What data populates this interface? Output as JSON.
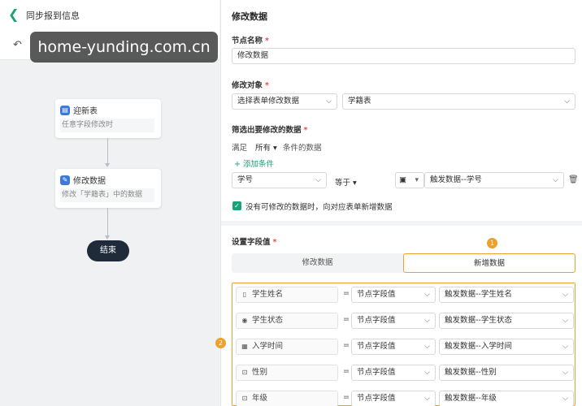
{
  "header": {
    "title": "同步报到信息"
  },
  "watermark": "home-yunding.com.cn",
  "flow": {
    "node1": {
      "title": "迎新表",
      "subtitle": "任意字段修改时"
    },
    "node2": {
      "title": "修改数据",
      "subtitle": "修改「学籍表」中的数据"
    },
    "end_label": "结束"
  },
  "panel": {
    "title": "修改数据",
    "node_name_label": "节点名称",
    "node_name_value": "修改数据",
    "target_label": "修改对象",
    "target_mode": "选择表单修改数据",
    "target_table": "学籍表",
    "filter_label": "筛选出要修改的数据",
    "filter_prefix": "满足",
    "filter_scope": "所有",
    "filter_suffix": "条件的数据",
    "add_condition": "添加条件",
    "condition": {
      "field": "学号",
      "operator": "等于",
      "value": "触发数据--学号"
    },
    "insert_if_none": "没有可修改的数据时，向对应表单新增数据",
    "set_fields_label": "设置字段值",
    "tabs": [
      "修改数据",
      "新增数据"
    ],
    "active_tab": 1,
    "badges": [
      "1",
      "2"
    ],
    "field_rows": [
      {
        "name": "学生姓名",
        "icon": "text-field-icon",
        "glyph": "▯",
        "eq": "=",
        "mode": "节点字段值",
        "value": "触发数据--学生姓名"
      },
      {
        "name": "学生状态",
        "icon": "radio-field-icon",
        "glyph": "◉",
        "eq": "=",
        "mode": "节点字段值",
        "value": "触发数据--学生状态"
      },
      {
        "name": "入学时间",
        "icon": "calendar-icon",
        "glyph": "▦",
        "eq": "=",
        "mode": "节点字段值",
        "value": "触发数据--入学时间"
      },
      {
        "name": "性别",
        "icon": "dropdown-field-icon",
        "glyph": "⊡",
        "eq": "=",
        "mode": "节点字段值",
        "value": "触发数据--性别"
      },
      {
        "name": "年级",
        "icon": "dropdown-field-icon",
        "glyph": "⊡",
        "eq": "=",
        "mode": "节点字段值",
        "value": "触发数据--年级"
      }
    ]
  },
  "colors": {
    "accent": "#1aa37a",
    "highlight": "#f0a02a",
    "required": "#e34d4d",
    "end_node": "#1f2a3a"
  }
}
